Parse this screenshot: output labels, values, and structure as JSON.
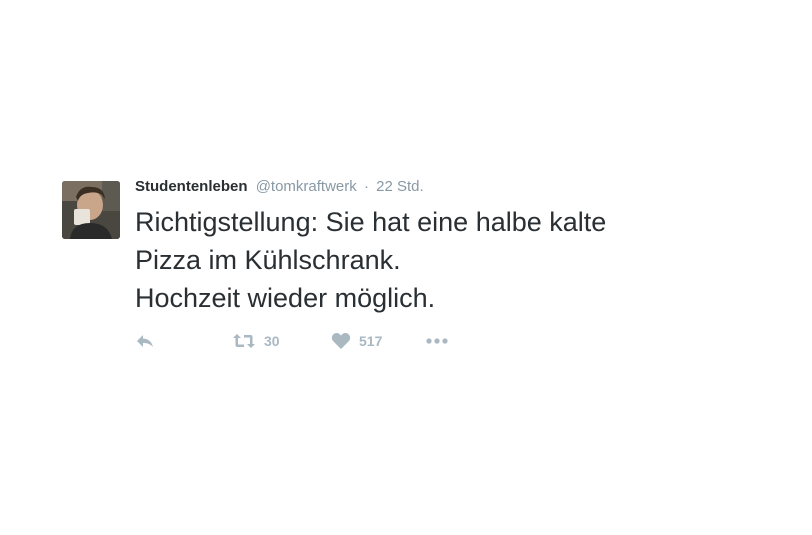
{
  "tweet": {
    "author_name": "Studentenleben",
    "handle": "@tomkraftwerk",
    "separator": "·",
    "timestamp": "22 Std.",
    "text_lines": [
      "Richtigstellung: Sie hat eine halbe kalte",
      "Pizza im Kühlschrank.",
      "Hochzeit wieder möglich."
    ]
  },
  "actions": {
    "reply_icon": "reply-icon",
    "retweet_icon": "retweet-icon",
    "retweet_count": "30",
    "like_icon": "heart-icon",
    "like_count": "517",
    "more_icon": "more-dots-icon"
  },
  "colors": {
    "text": "#292f33",
    "muted": "#8899a6",
    "icon": "#aab8c2",
    "background": "#ffffff"
  }
}
